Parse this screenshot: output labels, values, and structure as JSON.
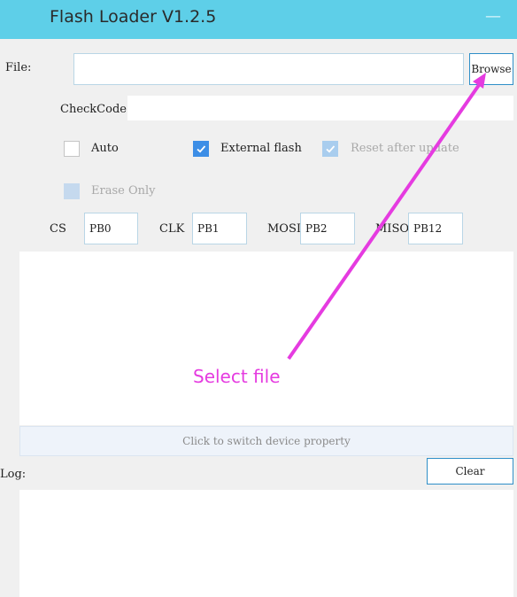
{
  "window": {
    "title": "Flash Loader V1.2.5",
    "minimize_glyph": "—"
  },
  "file": {
    "label": "File:",
    "value": "",
    "browse_label": "Browse"
  },
  "checkcode": {
    "label": "CheckCode",
    "value": ""
  },
  "options": {
    "auto": {
      "label": "Auto",
      "checked": false
    },
    "external_flash": {
      "label": "External flash",
      "checked": true
    },
    "reset_after_update": {
      "label": "Reset after update",
      "checked": true,
      "disabled": true
    },
    "erase_only": {
      "label": "Erase Only",
      "checked": false,
      "disabled": true
    }
  },
  "pins": {
    "cs": {
      "label": "CS",
      "value": "PB0"
    },
    "clk": {
      "label": "CLK",
      "value": "PB1"
    },
    "mosi": {
      "label": "MOSI",
      "value": "PB2"
    },
    "miso": {
      "label": "MISO",
      "value": "PB12"
    }
  },
  "device": {
    "switch_label": "Click to switch device property"
  },
  "log": {
    "label": "Log:",
    "clear_label": "Clear"
  },
  "annotation": {
    "text": "Select file",
    "color": "#e53be0"
  },
  "colors": {
    "titlebar": "#5ecfe8",
    "accent": "#3d8ee6",
    "button_border": "#2f8fc8"
  }
}
